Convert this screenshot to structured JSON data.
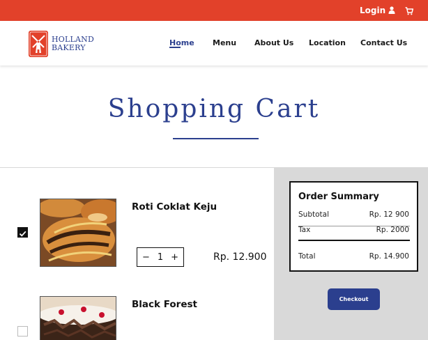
{
  "topbar": {
    "login_label": "Login"
  },
  "brand": {
    "line1": "HOLLAND",
    "line2": "BAKERY"
  },
  "nav": {
    "home": "Home",
    "menu": "Menu",
    "about": "About Us",
    "location": "Location",
    "contact": "Contact Us"
  },
  "page": {
    "title": "Shopping Cart"
  },
  "items": [
    {
      "name": "Roti Coklat Keju",
      "quantity": "1",
      "price": "Rp. 12.900",
      "checked": true
    },
    {
      "name": "Black Forest",
      "checked": false
    }
  ],
  "summary": {
    "title": "Order Summary",
    "subtotal_label": "Subtotal",
    "subtotal_value": "Rp. 12 900",
    "tax_label": "Tax",
    "tax_value": "Rp. 2000",
    "total_label": "Total",
    "total_value": "Rp. 14.900",
    "checkout_label": "Checkout"
  },
  "colors": {
    "topbar": "#e2412a",
    "brand_blue": "#2b3f8e",
    "summary_panel": "#d9d9d9"
  },
  "icons": {
    "login": "user-icon",
    "cart": "cart-icon",
    "checked": "check-icon"
  }
}
